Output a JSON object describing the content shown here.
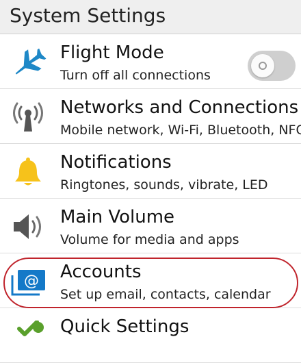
{
  "header": {
    "title": "System Settings"
  },
  "items": [
    {
      "id": "flight-mode",
      "icon": "airplane-icon",
      "label": "Flight Mode",
      "description": "Turn off all connections",
      "toggle": {
        "on": false
      }
    },
    {
      "id": "networks",
      "icon": "antenna-icon",
      "label": "Networks and Connections",
      "description": "Mobile network, Wi-Fi, Bluetooth, NFC"
    },
    {
      "id": "notifications",
      "icon": "bell-icon",
      "label": "Notifications",
      "description": "Ringtones, sounds, vibrate, LED"
    },
    {
      "id": "main-volume",
      "icon": "speaker-icon",
      "label": "Main Volume",
      "description": "Volume for media and apps"
    },
    {
      "id": "accounts",
      "icon": "at-sign-icon",
      "label": "Accounts",
      "description": "Set up email, contacts, calendar",
      "highlighted": true
    },
    {
      "id": "quick-settings",
      "icon": "checkmark-icon",
      "label": "Quick Settings",
      "description": ""
    }
  ],
  "colors": {
    "airplane": "#1e88c7",
    "bell": "#f6c21b",
    "accounts": "#1479c8",
    "check": "#5aa02c",
    "highlight_ring": "#c0242c"
  }
}
